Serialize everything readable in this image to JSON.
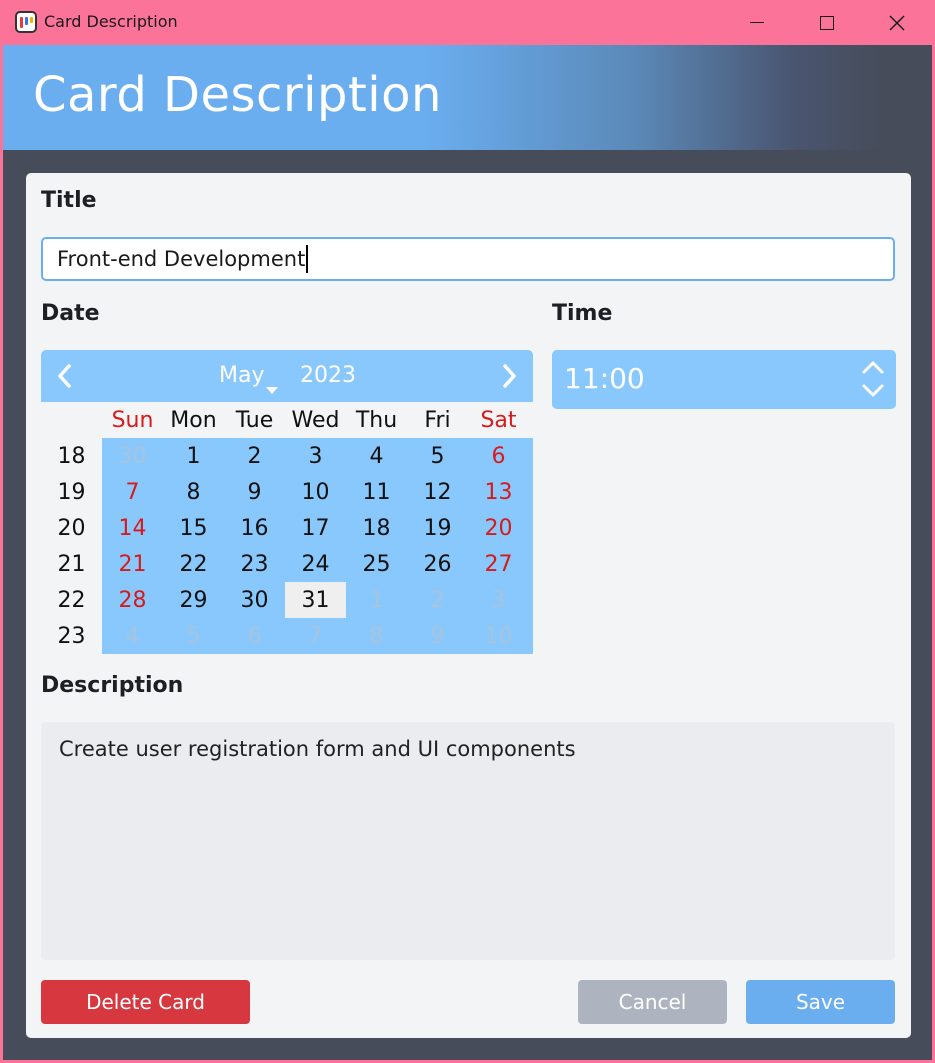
{
  "window": {
    "title": "Card Description"
  },
  "header": {
    "title": "Card Description"
  },
  "form": {
    "title_label": "Title",
    "title_value": "Front-end Development",
    "date_label": "Date",
    "time_label": "Time",
    "time_value": "11:00",
    "description_label": "Description",
    "description_value": "Create user registration form and UI components"
  },
  "calendar": {
    "month": "May",
    "year": "2023",
    "days_of_week": [
      "Sun",
      "Mon",
      "Tue",
      "Wed",
      "Thu",
      "Fri",
      "Sat"
    ],
    "weeks": [
      {
        "week": "18",
        "days": [
          "30",
          "1",
          "2",
          "3",
          "4",
          "5",
          "6"
        ]
      },
      {
        "week": "19",
        "days": [
          "7",
          "8",
          "9",
          "10",
          "11",
          "12",
          "13"
        ]
      },
      {
        "week": "20",
        "days": [
          "14",
          "15",
          "16",
          "17",
          "18",
          "19",
          "20"
        ]
      },
      {
        "week": "21",
        "days": [
          "21",
          "22",
          "23",
          "24",
          "25",
          "26",
          "27"
        ]
      },
      {
        "week": "22",
        "days": [
          "28",
          "29",
          "30",
          "31",
          "1",
          "2",
          "3"
        ]
      },
      {
        "week": "23",
        "days": [
          "4",
          "5",
          "6",
          "7",
          "8",
          "9",
          "10"
        ]
      }
    ],
    "selected_day": "31",
    "colors": {
      "weekend": "#d51b1b",
      "muted": "#a8c4dc",
      "background": "#89c8fc"
    }
  },
  "buttons": {
    "delete_label": "Delete Card",
    "cancel_label": "Cancel",
    "save_label": "Save"
  },
  "colors": {
    "titlebar": "#fb7399",
    "accent": "#6aaef0",
    "delete": "#d7383f",
    "cancel": "#aeb3c0",
    "window_bg": "#464c59"
  },
  "icons": {
    "app": "app-icon",
    "minimize": "minimize-icon",
    "maximize": "maximize-icon",
    "close": "close-icon",
    "prev": "chevron-left-icon",
    "next": "chevron-right-icon",
    "spin_up": "chevron-up-icon",
    "spin_down": "chevron-down-icon"
  }
}
